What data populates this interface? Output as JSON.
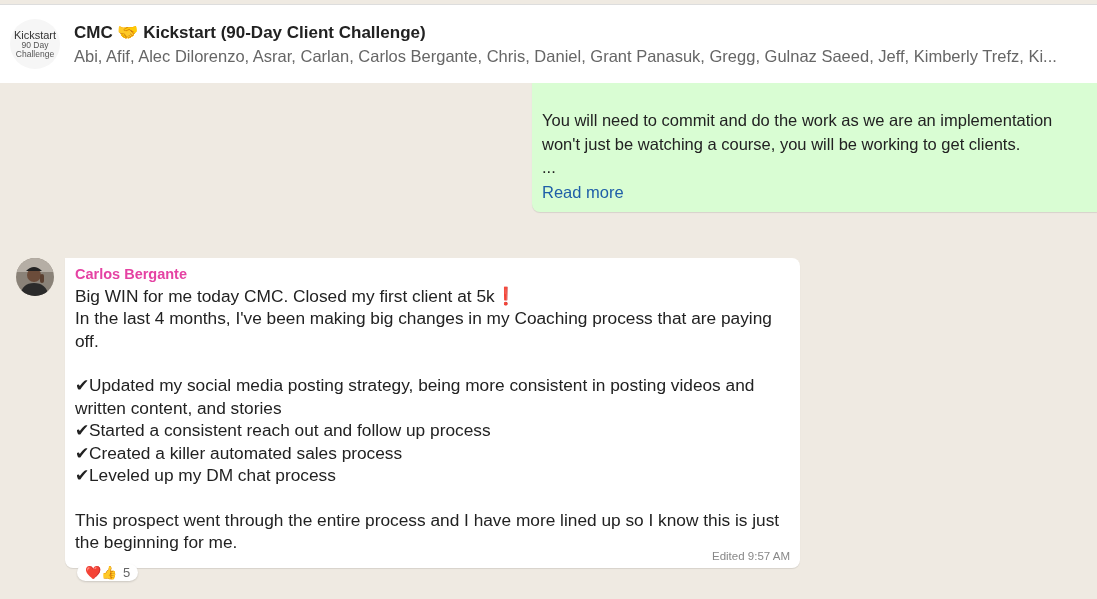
{
  "header": {
    "logo_lines": [
      "Kickstart",
      "90 Day",
      "Challenge"
    ],
    "title": "CMC 🤝 Kickstart (90-Day Client Challenge)",
    "members": "Abi, Afif, Alec Dilorenzo, Asrar, Carlan, Carlos Bergante, Chris, Daniel, Grant Panasuk, Gregg, Gulnaz Saeed, Jeff, Kimberly Trefz, Ki..."
  },
  "outgoing": {
    "lines": [
      "You will need to commit and do the work as we are an implementation",
      "won't just be watching a course, you will be working to get clients.",
      "..."
    ],
    "read_more": "Read more"
  },
  "incoming": {
    "sender": "Carlos Bergante",
    "paragraphs": [
      [
        "Big WIN for me today CMC. Closed my first client at 5k❗",
        "In the last 4 months, I've been making big changes in my Coaching process that are paying off."
      ],
      [
        "✔Updated my social media posting strategy, being more consistent in posting videos and written content, and stories",
        "✔Started a consistent reach out and follow up process",
        "✔Created a killer automated sales process",
        "✔Leveled up my DM chat process"
      ],
      [
        "This prospect went through the entire process and I have more lined up so I know this is just the beginning for me."
      ]
    ],
    "meta": "Edited 9:57 AM",
    "reactions": "❤️👍",
    "reaction_count": "5"
  }
}
